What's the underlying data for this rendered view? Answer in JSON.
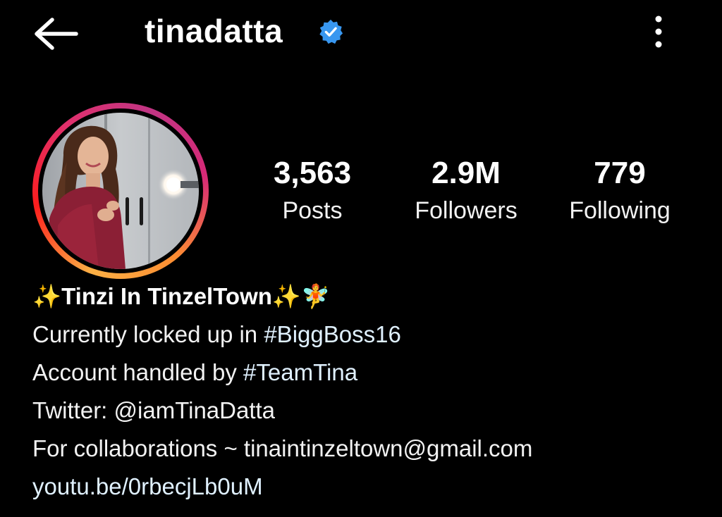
{
  "header": {
    "username": "tinadatta",
    "verified": true,
    "back_icon": "arrow-left-icon",
    "more_icon": "vertical-dots-icon"
  },
  "profile": {
    "avatar_ring_colors": [
      "#fcb045",
      "#fd1d1d",
      "#e1306c",
      "#c13584"
    ]
  },
  "stats": {
    "posts": {
      "value": "3,563",
      "label": "Posts"
    },
    "followers": {
      "value": "2.9M",
      "label": "Followers"
    },
    "following": {
      "value": "779",
      "label": "Following"
    }
  },
  "bio": {
    "name_line": {
      "prefix_emoji": "✨",
      "name": "Tinzi In TinzelTown",
      "suffix_emoji": "✨🧚"
    },
    "line2": {
      "text": "Currently locked up in ",
      "hashtag": "#BiggBoss16"
    },
    "line3": {
      "text": "Account handled by ",
      "hashtag": "#TeamTina"
    },
    "line4": {
      "text": "Twitter: @iamTinaDatta"
    },
    "line5": {
      "text": "For collaborations ~ tinaintinzeltown@gmail.com"
    },
    "link": "youtu.be/0rbecjLb0uM"
  },
  "colors": {
    "background": "#000000",
    "text": "#ffffff",
    "verified_badge": "#3897f0",
    "link": "#e0f1ff"
  }
}
